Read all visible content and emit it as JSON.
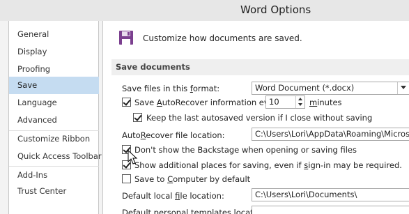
{
  "window": {
    "title": "Word Options"
  },
  "sidebar": {
    "items": [
      {
        "label": "General",
        "selected": false
      },
      {
        "label": "Display",
        "selected": false
      },
      {
        "label": "Proofing",
        "selected": false
      },
      {
        "label": "Save",
        "selected": true
      },
      {
        "label": "Language",
        "selected": false
      },
      {
        "label": "Advanced",
        "selected": false
      },
      {
        "label": "Customize Ribbon",
        "selected": false
      },
      {
        "label": "Quick Access Toolbar",
        "selected": false
      },
      {
        "label": "Add-Ins",
        "selected": false
      },
      {
        "label": "Trust Center",
        "selected": false
      }
    ]
  },
  "header": {
    "text": "Customize how documents are saved.",
    "icon": "floppy-disk-icon"
  },
  "section": {
    "title": "Save documents"
  },
  "save_format": {
    "label_pre": "Save files in this ",
    "label_u": "f",
    "label_post": "ormat:",
    "value": "Word Document (*.docx)"
  },
  "autorecover": {
    "checked": true,
    "label_pre": "Save ",
    "label_u": "A",
    "label_post": "utoRecover information every",
    "minutes_value": "10",
    "minutes_pre": "",
    "minutes_u": "m",
    "minutes_post": "inutes"
  },
  "keep_last": {
    "checked": true,
    "label": "Keep the last autosaved version if I close without saving"
  },
  "autorecover_location": {
    "label_pre": "Auto",
    "label_u": "R",
    "label_post": "ecover file location:",
    "value": "C:\\Users\\Lori\\AppData\\Roaming\\Microsoft\\Wo"
  },
  "backstage": {
    "checked": true,
    "label": "Don't show the Backstage when opening or saving files"
  },
  "additional_places": {
    "checked": true,
    "label_pre": "Show additional places for saving, even if ",
    "label_u": "s",
    "label_post": "ign-in may be required."
  },
  "save_computer": {
    "checked": false,
    "label_pre": "Save to ",
    "label_u": "C",
    "label_post": "omputer by default"
  },
  "default_local": {
    "label_pre": "Default local ",
    "label_u": "f",
    "label_post": "ile location:",
    "value": "C:\\Users\\Lori\\Documents\\"
  },
  "default_personal": {
    "label": "Default personal templates location:"
  },
  "colors": {
    "selected_nav": "#c5dcf1",
    "save_icon": "#7b3f8f"
  }
}
